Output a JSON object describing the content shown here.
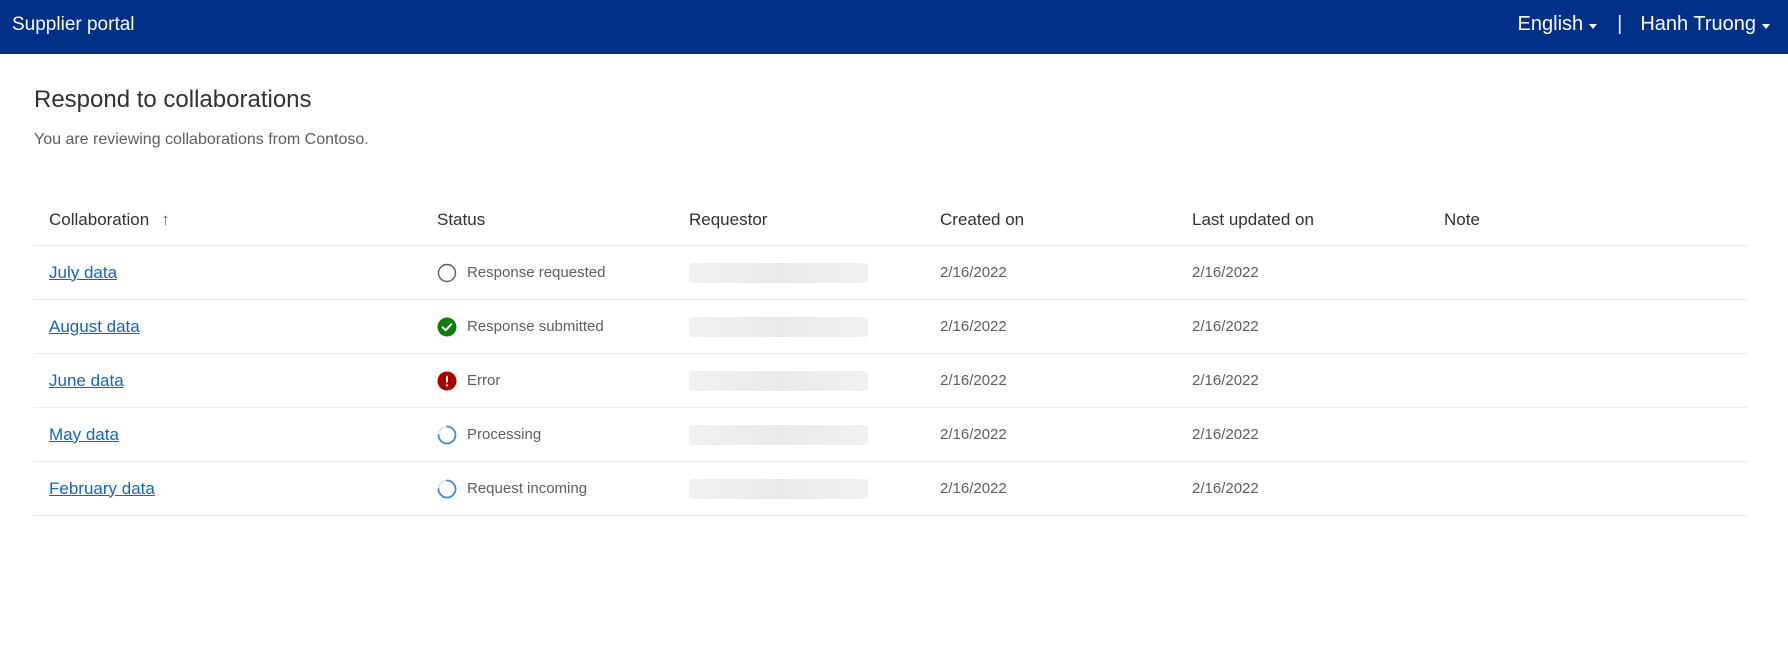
{
  "header": {
    "app_title": "Supplier portal",
    "language_label": "English",
    "separator": "|",
    "user_name": "Hanh Truong"
  },
  "page": {
    "title": "Respond to collaborations",
    "subtitle": "You are reviewing collaborations from Contoso."
  },
  "table": {
    "columns": {
      "collaboration": "Collaboration",
      "status": "Status",
      "requestor": "Requestor",
      "created_on": "Created on",
      "last_updated_on": "Last updated on",
      "note": "Note"
    },
    "sort_indicator": "↑",
    "rows": [
      {
        "name": "July data",
        "status": "Response requested",
        "status_icon": "empty-circle-icon",
        "created_on": "2/16/2022",
        "last_updated_on": "2/16/2022",
        "note": ""
      },
      {
        "name": "August data",
        "status": "Response submitted",
        "status_icon": "check-circle-icon",
        "created_on": "2/16/2022",
        "last_updated_on": "2/16/2022",
        "note": ""
      },
      {
        "name": "June data",
        "status": "Error",
        "status_icon": "error-circle-icon",
        "created_on": "2/16/2022",
        "last_updated_on": "2/16/2022",
        "note": ""
      },
      {
        "name": "May data",
        "status": "Processing",
        "status_icon": "spinner-icon",
        "created_on": "2/16/2022",
        "last_updated_on": "2/16/2022",
        "note": ""
      },
      {
        "name": "February data",
        "status": "Request incoming",
        "status_icon": "spinner-icon",
        "created_on": "2/16/2022",
        "last_updated_on": "2/16/2022",
        "note": ""
      }
    ]
  },
  "colors": {
    "topbar": "#003087",
    "link": "#1264c5",
    "success": "#107c10",
    "error": "#a80000",
    "spinner": "#4a86d4"
  }
}
